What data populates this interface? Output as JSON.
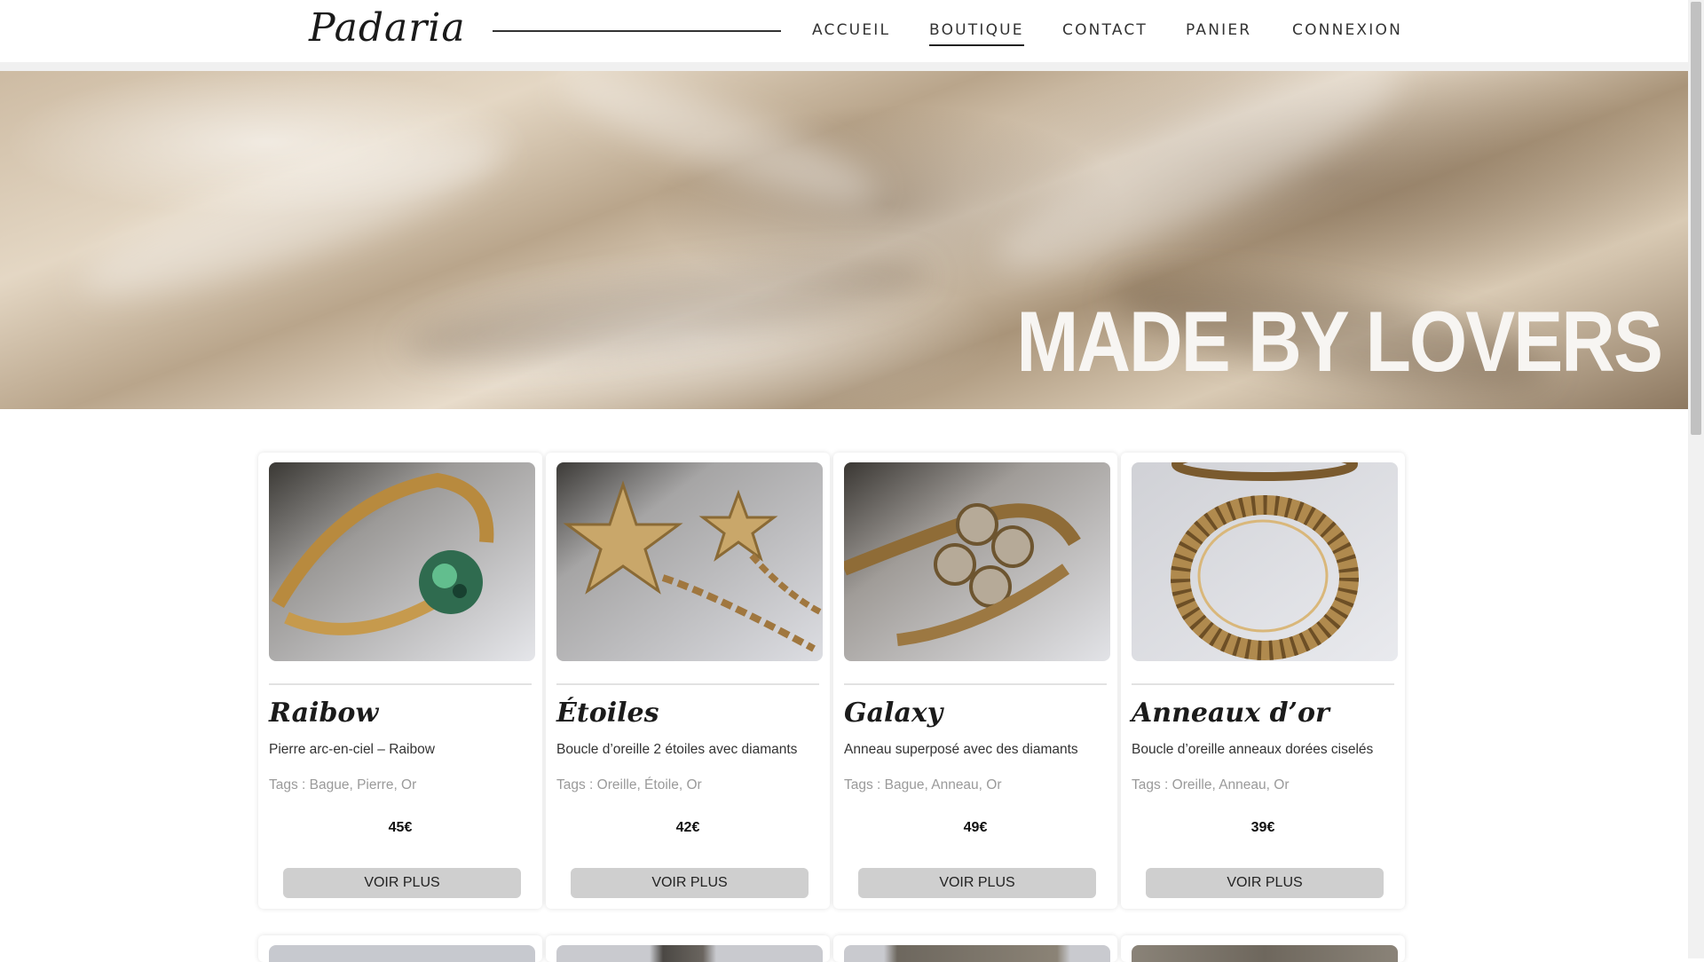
{
  "nav": {
    "logo": "Padaria",
    "links": [
      "ACCUEIL",
      "BOUTIQUE",
      "CONTACT",
      "PANIER",
      "CONNEXION"
    ],
    "active": "BOUTIQUE"
  },
  "hero": {
    "title": "MADE BY LOVERS"
  },
  "products": [
    {
      "title": "Raibow",
      "desc": "Pierre arc-en-ciel – Raibow",
      "tags": "Tags : Bague, Pierre, Or",
      "price": "45€",
      "button": "VOIR PLUS",
      "image": "ring-green-stone"
    },
    {
      "title": "Étoiles",
      "desc": "Boucle d’oreille 2 étoiles avec diamants",
      "tags": "Tags : Oreille, Étoile, Or",
      "price": "42€",
      "button": "VOIR PLUS",
      "image": "star-earrings"
    },
    {
      "title": "Galaxy",
      "desc": "Anneau superposé avec des diamants",
      "tags": "Tags : Bague, Anneau, Or",
      "price": "49€",
      "button": "VOIR PLUS",
      "image": "diamond-ring"
    },
    {
      "title": "Anneaux d’or",
      "desc": "Boucle d’oreille anneaux dorées ciselés",
      "tags": "Tags : Oreille, Anneau, Or",
      "price": "39€",
      "button": "VOIR PLUS",
      "image": "gold-hoop"
    }
  ],
  "colors": {
    "button_bg": "#cfcfcf",
    "accent_text": "#1b1b1b",
    "tags_text": "#9a9a9a"
  }
}
